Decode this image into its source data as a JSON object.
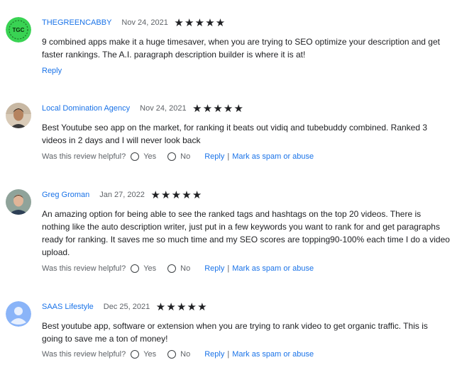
{
  "stars_glyph": "★",
  "reviews": [
    {
      "author": "THEGREENCABBY",
      "date": "Nov 24, 2021",
      "rating": 5,
      "avatar": {
        "text": "TGC",
        "bg": "#39d353",
        "icon": "green-circle-logo"
      },
      "text": "9 combined apps make it a huge timesaver, when you are trying to SEO optimize your description and get faster rankings.  The A.I. paragraph description builder is where it is at!",
      "reply": "Reply"
    },
    {
      "author": "Local Domination Agency",
      "date": "Nov 24, 2021",
      "rating": 5,
      "avatar": {
        "icon": "person-photo"
      },
      "text": "Best Youtube seo app on the market, for ranking it beats out vidiq and tubebuddy combined.  Ranked 3 videos in 2 days and I will never look back",
      "helpful": "Was this review helpful?",
      "yes": "Yes",
      "no": "No",
      "reply": "Reply",
      "sep": "|",
      "spam": "Mark as spam or abuse"
    },
    {
      "author": "Greg Groman",
      "date": "Jan 27, 2022",
      "rating": 5,
      "avatar": {
        "icon": "person-photo"
      },
      "text": "An amazing option for being able to see the ranked tags and hashtags on the top 20 videos.  There is nothing like the auto description writer, just put in a few keywords you want to rank for and get paragraphs ready for ranking. It saves me so much time and my SEO scores are topping90-100% each time I do a video upload.",
      "helpful": "Was this review helpful?",
      "yes": "Yes",
      "no": "No",
      "reply": "Reply",
      "sep": "|",
      "spam": "Mark as spam or abuse"
    },
    {
      "author": "SAAS Lifestyle",
      "date": "Dec 25, 2021",
      "rating": 5,
      "avatar": {
        "icon": "default-person-avatar",
        "bg": "#8ab4f8"
      },
      "text": "Best youtube app, software or extension when you are trying to rank video to get organic traffic.  This is going to save me a ton of money!",
      "helpful": "Was this review helpful?",
      "yes": "Yes",
      "no": "No",
      "reply": "Reply",
      "sep": "|",
      "spam": "Mark as spam or abuse"
    }
  ]
}
